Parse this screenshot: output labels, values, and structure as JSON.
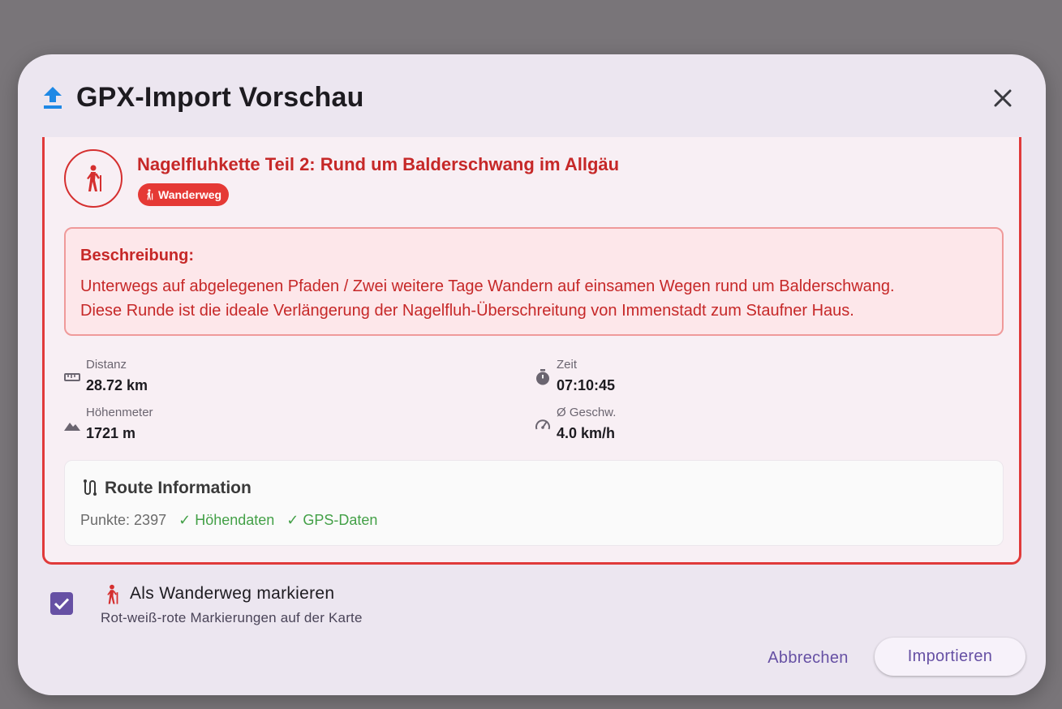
{
  "dialog": {
    "title": "GPX-Import Vorschau",
    "title_icon": "upload-icon",
    "close_icon": "close-icon"
  },
  "route": {
    "name": "Nagelfluhkette Teil 2: Rund um Balderschwang im Allgäu",
    "type_badge": "Wanderweg",
    "avatar_icon": "hiking-icon",
    "description_label": "Beschreibung:",
    "description_line1": "Unterwegs auf abgelegenen Pfaden / Zwei weitere Tage Wandern auf einsamen Wegen rund um Balderschwang.",
    "description_line2": "Diese Runde ist die ideale Verlängerung der Nagelfluh-Überschreitung von Immenstadt zum Staufner Haus."
  },
  "stats": {
    "distance": {
      "label": "Distanz",
      "value": "28.72 km",
      "icon": "ruler-icon"
    },
    "time": {
      "label": "Zeit",
      "value": "07:10:45",
      "icon": "timer-icon"
    },
    "elevation": {
      "label": "Höhenmeter",
      "value": "1721 m",
      "icon": "terrain-icon"
    },
    "speed": {
      "label": "Ø Geschw.",
      "value": "4.0 km/h",
      "icon": "speed-icon"
    }
  },
  "route_info": {
    "title": "Route Information",
    "icon": "route-icon",
    "points": "Punkte: 2397",
    "elevation_data": "✓ Höhendaten",
    "gps_data": "✓ GPS-Daten"
  },
  "hiking_option": {
    "checked": true,
    "label": "Als Wanderweg markieren",
    "sublabel": "Rot-weiß-rote Markierungen auf der Karte"
  },
  "actions": {
    "cancel": "Abbrechen",
    "import": "Importieren"
  },
  "colors": {
    "accent": "#6650a4",
    "route_red": "#c62828",
    "badge_red": "#e53935",
    "success_green": "#43a047",
    "upload_blue": "#1e88e5"
  }
}
